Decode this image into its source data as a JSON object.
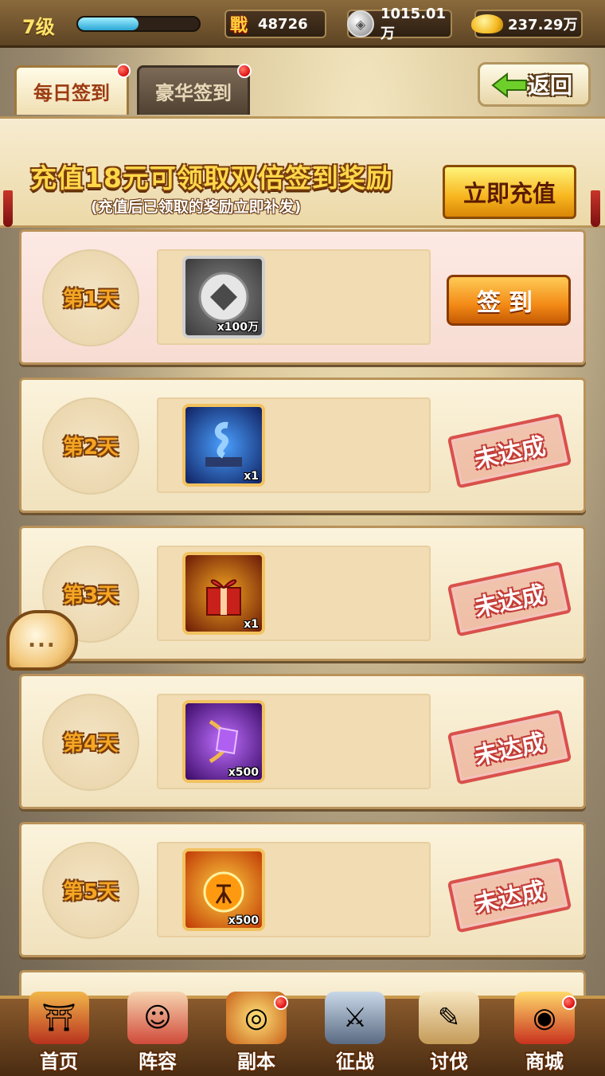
{
  "topbar": {
    "level": "7级",
    "xp_fraction": 0.5,
    "power_icon": "戰",
    "power_value": "48726",
    "silver_value": "1015.01万",
    "gold_value": "237.29万"
  },
  "tabs": [
    {
      "label": "每日签到",
      "active": true,
      "badge": true
    },
    {
      "label": "豪华签到",
      "active": false,
      "badge": true
    }
  ],
  "back_label": "返回",
  "banner": {
    "title": "充值18元可领取双倍签到奖励",
    "subtitle": "(充值后已领取的奖励立即补发)",
    "button": "立即充值"
  },
  "days": [
    {
      "label": "第1天",
      "item_icon": "silver-coin-icon",
      "qty": "x100万",
      "action": "签到",
      "state": "available"
    },
    {
      "label": "第2天",
      "item_icon": "serpent-statue-icon",
      "qty": "x1",
      "action": "未达成",
      "state": "locked"
    },
    {
      "label": "第3天",
      "item_icon": "gift-box-icon",
      "qty": "x1",
      "action": "未达成",
      "state": "locked"
    },
    {
      "label": "第4天",
      "item_icon": "purple-bow-gem-icon",
      "qty": "x500",
      "action": "未达成",
      "state": "locked"
    },
    {
      "label": "第5天",
      "item_icon": "fire-orb-icon",
      "qty": "x500",
      "action": "未达成",
      "state": "locked"
    }
  ],
  "chat_glyph": "...",
  "nav": [
    {
      "label": "首页",
      "icon": "home-pagoda-icon",
      "badge": false
    },
    {
      "label": "阵容",
      "icon": "lineup-heroes-icon",
      "badge": false
    },
    {
      "label": "副本",
      "icon": "dungeon-portal-icon",
      "badge": true
    },
    {
      "label": "征战",
      "icon": "crossed-swords-icon",
      "badge": false
    },
    {
      "label": "讨伐",
      "icon": "scroll-sword-icon",
      "badge": false
    },
    {
      "label": "商城",
      "icon": "shop-icon",
      "badge": true
    }
  ],
  "colors": {
    "accent_gold": "#ffd84a",
    "stamp_red": "#d9514c",
    "sign_orange": "#f38a16"
  }
}
